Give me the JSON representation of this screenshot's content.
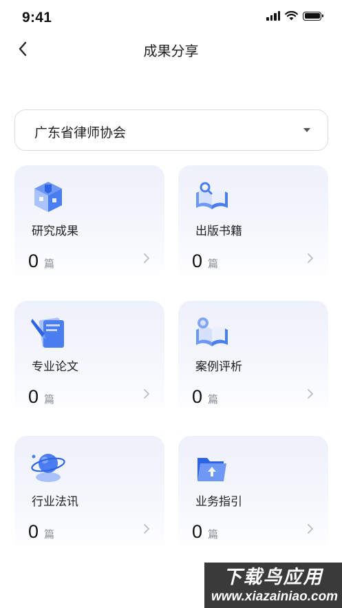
{
  "status_bar": {
    "time": "9:41"
  },
  "nav": {
    "title": "成果分享"
  },
  "org_select": {
    "value": "广东省律师协会"
  },
  "cards": [
    {
      "title": "研究成果",
      "count": "0",
      "unit": "篇",
      "icon": "research-cube-icon"
    },
    {
      "title": "出版书籍",
      "count": "0",
      "unit": "篇",
      "icon": "open-book-icon"
    },
    {
      "title": "专业论文",
      "count": "0",
      "unit": "篇",
      "icon": "paper-pen-icon"
    },
    {
      "title": "案例评析",
      "count": "0",
      "unit": "篇",
      "icon": "case-book-icon"
    },
    {
      "title": "行业法讯",
      "count": "0",
      "unit": "篇",
      "icon": "globe-news-icon"
    },
    {
      "title": "业务指引",
      "count": "0",
      "unit": "篇",
      "icon": "folder-guide-icon"
    }
  ],
  "watermark": {
    "title": "下载鸟应用",
    "url": "www.xiazainiao.com"
  },
  "colors": {
    "icon_blue": "#4a7df0",
    "icon_light": "#a9c2fb",
    "card_bg": "#eef1fb"
  }
}
